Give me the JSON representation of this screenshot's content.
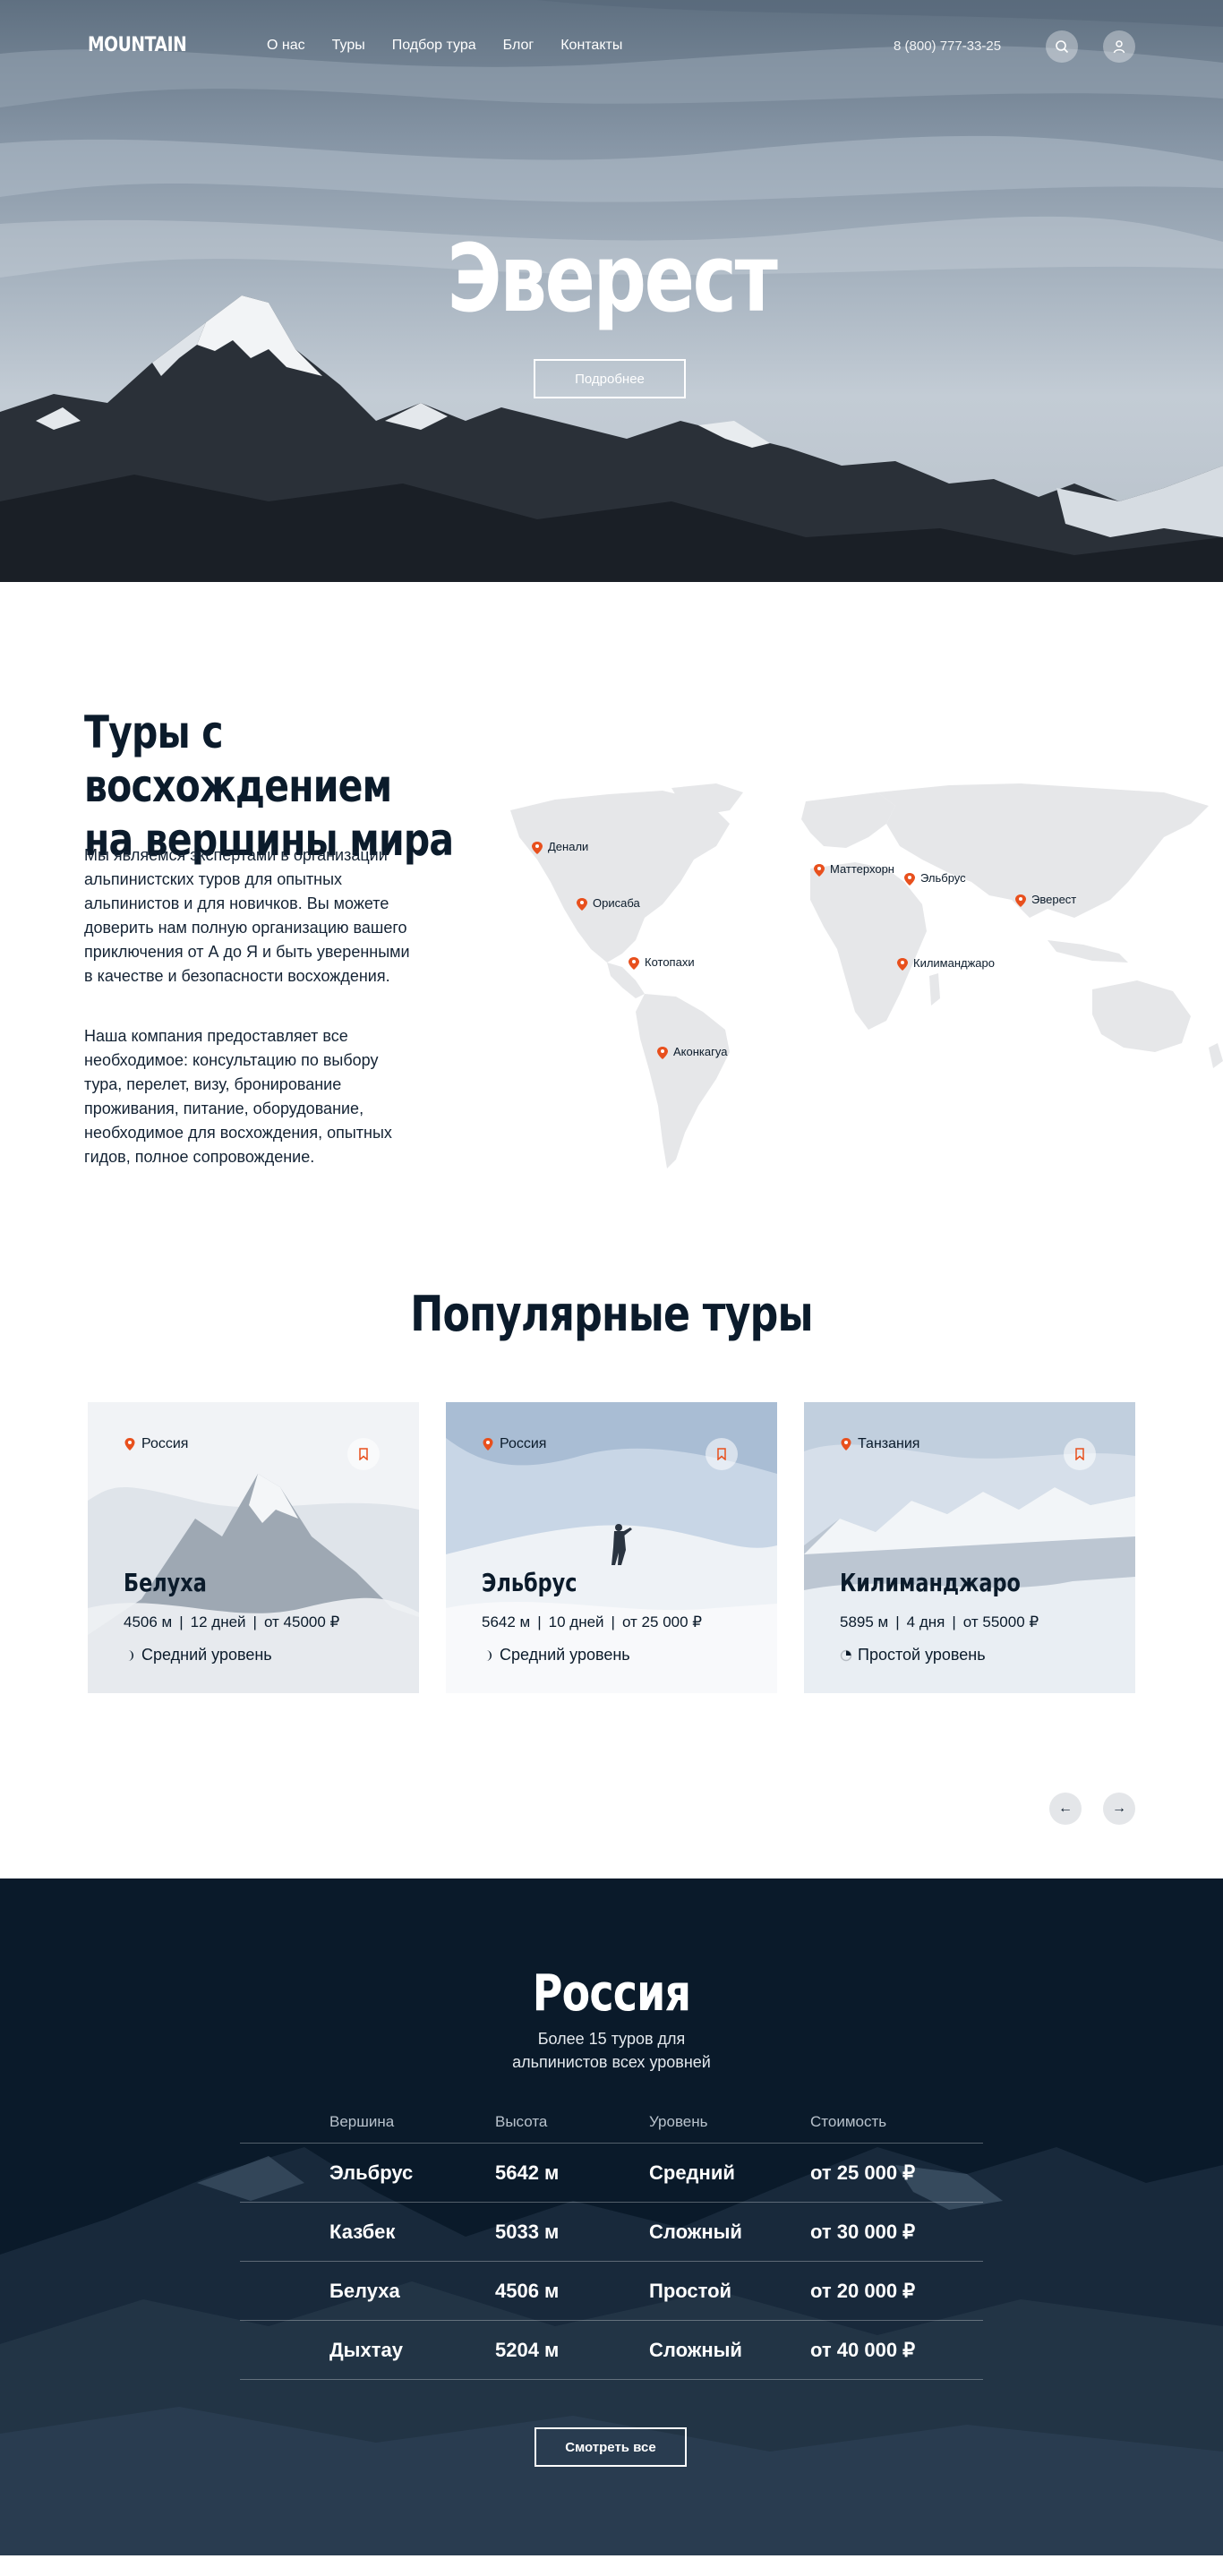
{
  "header": {
    "logo": "MOUNTAIN",
    "menu": [
      "О нас",
      "Туры",
      "Подбор тура",
      "Блог",
      "Контакты"
    ],
    "phone": "8 (800) 777-33-25"
  },
  "hero": {
    "title": "Эверест",
    "button_label": "Подробнее"
  },
  "about": {
    "title_line1": "Туры с восхождением",
    "title_line2": "на вершины мира",
    "paragraph1": "Мы являемся экспертами в организации альпинистских туров для опытных альпинистов и для новичков. Вы можете доверить нам полную организацию вашего приключения от А до Я и быть уверенными в качестве и безопасности восхождения.",
    "paragraph2": "Наша компания предоставляет все необходимое: консультацию по выбору тура, перелет, визу, бронирование проживания, питание, оборудование, необходимое для восхождения, опытных гидов, полное сопровождение.",
    "map_pins": [
      "Денали",
      "Маттерхорн",
      "Эльбрус",
      "Орисаба",
      "Эверест",
      "Котопахи",
      "Килиманджаро",
      "Аконкагуа"
    ]
  },
  "popular": {
    "title": "Популярные туры",
    "cards": [
      {
        "country": "Россия",
        "title": "Белуха",
        "height": "4506 м",
        "duration": "12 дней",
        "price": "от 45000 ₽",
        "level": "Средний уровень"
      },
      {
        "country": "Россия",
        "title": "Эльбрус",
        "height": "5642 м",
        "duration": "10 дней",
        "price": "от 25 000 ₽",
        "level": "Средний уровень"
      },
      {
        "country": "Танзания",
        "title": "Килиманджаро",
        "height": "5895 м",
        "duration": "4 дня",
        "price": "от 55000   ₽",
        "level": "Простой уровень"
      }
    ],
    "prev_label": "←",
    "next_label": "→"
  },
  "russia": {
    "title": "Россия",
    "subtitle_line1": "Более 15 туров для",
    "subtitle_line2": "альпинистов всех уровней",
    "columns": [
      "Вершина",
      "Высота",
      "Уровень",
      "Стоимость"
    ],
    "rows": [
      [
        "Эльбрус",
        "5642 м",
        "Средний",
        "от 25 000 ₽"
      ],
      [
        "Казбек",
        "5033 м",
        "Сложный",
        "от 30 000 ₽"
      ],
      [
        "Белуха",
        "4506 м",
        "Простой",
        "от 20 000 ₽"
      ],
      [
        "Дыхтау",
        "5204 м",
        "Сложный",
        "от 40 000 ₽"
      ]
    ],
    "button_label": "Смотреть все"
  },
  "colors": {
    "accent": "#e8501d",
    "dark": "#0a1a2a",
    "map_land": "#e6e7e9"
  }
}
